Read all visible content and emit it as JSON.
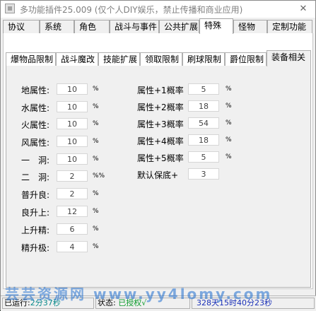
{
  "title": "多功能插件25.009 (仅个人DIY娱乐，禁止传播和商业应用)",
  "main_tabs": [
    "协议",
    "系统",
    "角色",
    "战斗与事件",
    "公共扩展",
    "特殊",
    "怪物",
    "定制功能"
  ],
  "main_active": "特殊",
  "sub_tabs": [
    "爆物品限制",
    "战斗魔改",
    "技能扩展",
    "领取限制",
    "刷球限制",
    "爵位限制",
    "装备相关"
  ],
  "sub_active": "装备相关",
  "left_fields": [
    {
      "label": "地属性:",
      "value": "10",
      "unit": "%"
    },
    {
      "label": "水属性:",
      "value": "10",
      "unit": "%"
    },
    {
      "label": "火属性:",
      "value": "10",
      "unit": "%"
    },
    {
      "label": "风属性:",
      "value": "10",
      "unit": "%"
    },
    {
      "label": "一　洞:",
      "value": "10",
      "unit": "%"
    },
    {
      "label": "二　洞:",
      "value": "2",
      "unit": "%%"
    },
    {
      "label": "普升良:",
      "value": "2",
      "unit": "%"
    },
    {
      "label": "良升上:",
      "value": "12",
      "unit": "%"
    },
    {
      "label": "上升精:",
      "value": "6",
      "unit": "%"
    },
    {
      "label": "精升极:",
      "value": "4",
      "unit": "%"
    }
  ],
  "right_fields": [
    {
      "label": "属性+1概率",
      "value": "5",
      "unit": "%"
    },
    {
      "label": "属性+2概率",
      "value": "18",
      "unit": "%"
    },
    {
      "label": "属性+3概率",
      "value": "54",
      "unit": "%"
    },
    {
      "label": "属性+4概率",
      "value": "18",
      "unit": "%"
    },
    {
      "label": "属性+5概率",
      "value": "5",
      "unit": "%"
    },
    {
      "label": "默认保底+",
      "value": "3",
      "unit": ""
    }
  ],
  "status": {
    "runtime_label": "已运行:",
    "runtime_value": "2分37秒",
    "state_label": "状态:",
    "state_value": "已授权√",
    "remaining": "328天15时40分23秒"
  },
  "watermark": "芸芸资源网 www.yy4lomy.com",
  "colors": {
    "runtime": "#0a8a8a",
    "authorized": "#0a9a2a",
    "remaining": "#1a30b8"
  }
}
